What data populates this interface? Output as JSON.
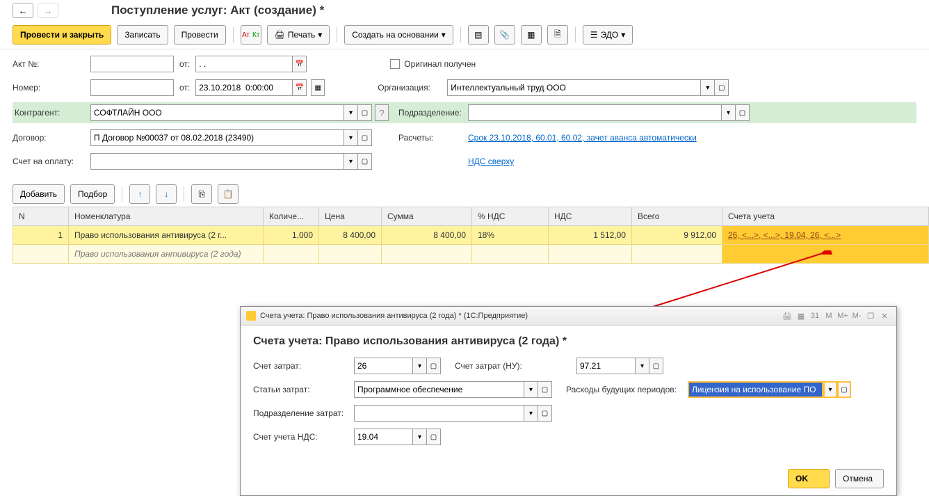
{
  "page_title": "Поступление услуг: Акт (создание) *",
  "toolbar": {
    "submit_close": "Провести и закрыть",
    "save": "Записать",
    "submit": "Провести",
    "print": "Печать",
    "create_based": "Создать на основании",
    "edo": "ЭДО"
  },
  "form": {
    "act_no_label": "Акт №:",
    "act_no_value": "",
    "from_label": "от:",
    "from_value": ". .",
    "number_label": "Номер:",
    "number_value": "",
    "datetime_value": "23.10.2018  0:00:00",
    "original_received": "Оригинал получен",
    "org_label": "Организация:",
    "org_value": "Интеллектуальный труд ООО",
    "counterparty_label": "Контрагент:",
    "counterparty_value": "СОФТЛАЙН ООО",
    "subdivision_label": "Подразделение:",
    "subdivision_value": "",
    "contract_label": "Договор:",
    "contract_value": "П Договор №00037 от 08.02.2018 (23490)",
    "calc_label": "Расчеты:",
    "calc_link": "Срок 23.10.2018, 60.01, 60.02, зачет аванса автоматически",
    "invoice_label": "Счет на оплату:",
    "invoice_value": "",
    "vat_link": "НДС сверху"
  },
  "grid_toolbar": {
    "add": "Добавить",
    "pick": "Подбор"
  },
  "table": {
    "headers": [
      "N",
      "Номенклатура",
      "Количе...",
      "Цена",
      "Сумма",
      "% НДС",
      "НДС",
      "Всего",
      "Счета учета"
    ],
    "rows": [
      {
        "n": "1",
        "nomenclature": "Право использования антивируса (2 г...",
        "nomenclature_sub": "Право использования антивируса (2 года)",
        "qty": "1,000",
        "price": "8 400,00",
        "sum": "8 400,00",
        "vat_pct": "18%",
        "vat": "1 512,00",
        "total": "9 912,00",
        "accounts": "26, <...>, <...>, 19.04, 26, <...>"
      }
    ]
  },
  "dialog": {
    "titlebar": "Счета учета: Право использования антивируса (2 года) *  (1С:Предприятие)",
    "title": "Счета учета: Право использования антивируса (2 года) *",
    "cost_account_label": "Счет затрат:",
    "cost_account_value": "26",
    "cost_account_nu_label": "Счет затрат (НУ):",
    "cost_account_nu_value": "97.21",
    "cost_items_label": "Статьи затрат:",
    "cost_items_value": "Программное обеспечение",
    "future_exp_label": "Расходы будущих периодов:",
    "future_exp_value": "Лицензия на использование ПО",
    "subdiv_label": "Подразделение затрат:",
    "subdiv_value": "",
    "vat_account_label": "Счет учета НДС:",
    "vat_account_value": "19.04",
    "ok": "OK",
    "cancel": "Отмена"
  }
}
